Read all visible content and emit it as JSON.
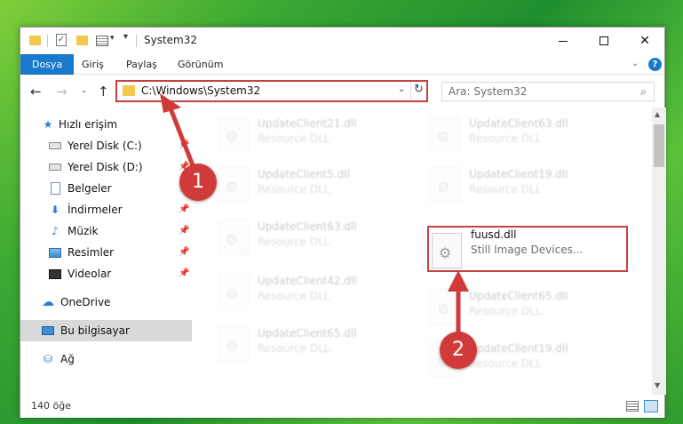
{
  "window": {
    "title": "System32",
    "qa_check": "✓",
    "qa_dropdown": "▾",
    "qa_customize": "▾",
    "min_label": "",
    "close_label": "✕"
  },
  "ribbon": {
    "tabs": [
      "Dosya",
      "Giriş",
      "Paylaş",
      "Görünüm"
    ],
    "active_tab": "Dosya",
    "collapse": "⌄",
    "help": "?"
  },
  "nav": {
    "back": "←",
    "forward": "→",
    "recent": "⌄",
    "up": "↑",
    "address": "C:\\Windows\\System32",
    "address_dropdown": "⌄",
    "refresh": "↻",
    "search_placeholder": "Ara: System32",
    "search_icon": "⌕"
  },
  "sidebar": {
    "pin": "📌",
    "items": [
      {
        "label": "Hızlı erişim",
        "icon": "star-icon",
        "glyph": "★",
        "pinned": false
      },
      {
        "label": "Yerel Disk (C:)",
        "icon": "drive-icon",
        "glyph": "",
        "pinned": true
      },
      {
        "label": "Yerel Disk (D:)",
        "icon": "drive-icon",
        "glyph": "",
        "pinned": true
      },
      {
        "label": "Belgeler",
        "icon": "documents-icon",
        "glyph": "",
        "pinned": true
      },
      {
        "label": "İndirmeler",
        "icon": "download-icon",
        "glyph": "⬇",
        "pinned": true
      },
      {
        "label": "Müzik",
        "icon": "music-icon",
        "glyph": "♪",
        "pinned": true
      },
      {
        "label": "Resimler",
        "icon": "pictures-icon",
        "glyph": "",
        "pinned": true
      },
      {
        "label": "Videolar",
        "icon": "video-icon",
        "glyph": "",
        "pinned": true
      },
      {
        "label": "OneDrive",
        "icon": "cloud-icon",
        "glyph": "☁",
        "pinned": false
      },
      {
        "label": "Bu bilgisayar",
        "icon": "computer-icon",
        "glyph": "",
        "pinned": false,
        "selected": true
      },
      {
        "label": "Ağ",
        "icon": "network-icon",
        "glyph": "⛁",
        "pinned": false
      }
    ]
  },
  "files": {
    "left": [
      {
        "name": "UpdateClient21.dll",
        "type": "Resource DLL"
      },
      {
        "name": "UpdateClient5.dll",
        "type": "Resource DLL"
      },
      {
        "name": "UpdateClient63.dll",
        "type": "Resource DLL"
      },
      {
        "name": "UpdateClient42.dll",
        "type": "Resource DLL"
      },
      {
        "name": "UpdateClient65.dll",
        "type": "Resource DLL"
      }
    ],
    "right": [
      {
        "name": "UpdateClient63.dll",
        "type": "Resource DLL"
      },
      {
        "name": "UpdateClient19.dll",
        "type": "Resource DLL"
      },
      {
        "name": "fuusd.dll",
        "type": "Still Image Devices...",
        "highlighted": true
      },
      {
        "name": "UpdateClient65.dll",
        "type": "Resource DLL"
      },
      {
        "name": "UpdateClient19.dll",
        "type": "Resource DLL"
      }
    ]
  },
  "scrollbar": {
    "up": "▲",
    "down": "▼"
  },
  "status": {
    "item_count": "140 öğe"
  },
  "annotations": {
    "badge_1": "1",
    "badge_2": "2",
    "accent": "#d13a3a"
  }
}
